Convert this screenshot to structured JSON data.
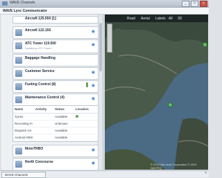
{
  "window": {
    "title": "WAVE Channels",
    "app_title": "WAVE Lync Communicator",
    "buttons": [
      "_",
      "□",
      "×"
    ]
  },
  "channels": [
    {
      "label": "Aircraft 125.550 [1]",
      "sub": ""
    },
    {
      "label": "Aircraft 122.150",
      "sub": ""
    },
    {
      "label": "ATC Tower 119.500",
      "sub": "Speaking: ATC Tower"
    },
    {
      "label": "Baggage Handling",
      "sub": ""
    },
    {
      "label": "Customer Service",
      "sub": ""
    },
    {
      "label": "Fueling Control (8)",
      "sub": ""
    },
    {
      "label": "Maintenance Control (4)",
      "sub": ""
    },
    {
      "label": "MotoTRBO",
      "sub": ""
    },
    {
      "label": "North Concourse",
      "sub": ""
    }
  ],
  "table": {
    "columns": [
      "Name",
      "Activity",
      "Status",
      "Location"
    ],
    "rows": [
      [
        "Tyrr01",
        "",
        "Available",
        "•"
      ],
      [
        "Recording Fr",
        "",
        "Unknown",
        ""
      ],
      [
        "Dispatch Ce",
        "",
        "Available",
        ""
      ],
      [
        "Android WMI",
        "",
        "Available",
        ""
      ]
    ]
  },
  "map": {
    "toolbar": [
      "Road",
      "Aerial",
      "Labels",
      "All",
      "3D"
    ],
    "watermark": "© 2010 Microsoft Corporation  © 2010 NAVTEQ"
  },
  "statusbar": {
    "tab": "WAVE Channels",
    "close": "×"
  },
  "colors": {
    "accent": "#3a7bd5",
    "status_green": "#6aa45a"
  }
}
